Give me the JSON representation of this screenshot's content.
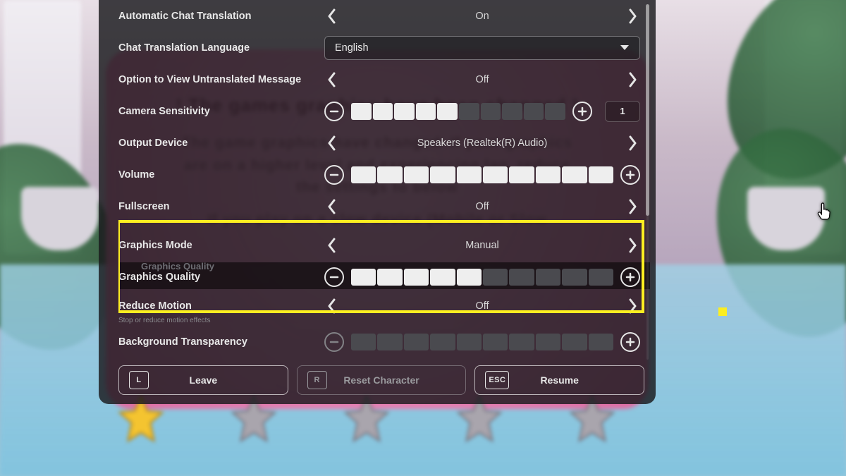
{
  "settings": {
    "autoChatTranslation": {
      "label": "Automatic Chat Translation",
      "value": "On"
    },
    "chatTranslationLanguage": {
      "label": "Chat Translation Language",
      "value": "English"
    },
    "viewUntranslated": {
      "label": "Option to View Untranslated Message",
      "value": "Off"
    },
    "cameraSensitivity": {
      "label": "Camera Sensitivity",
      "filled": 5,
      "total": 10,
      "numeric": "1"
    },
    "outputDevice": {
      "label": "Output Device",
      "value": "Speakers (Realtek(R) Audio)"
    },
    "volume": {
      "label": "Volume",
      "filled": 10,
      "total": 10
    },
    "fullscreen": {
      "label": "Fullscreen",
      "value": "Off"
    },
    "graphicsMode": {
      "label": "Graphics Mode",
      "value": "Manual"
    },
    "graphicsQuality": {
      "label": "Graphics Quality",
      "filled": 5,
      "total": 10
    },
    "reduceMotion": {
      "label": "Reduce Motion",
      "value": "Off",
      "subtext": "Stop or reduce motion effects"
    },
    "backgroundTransparency": {
      "label": "Background Transparency",
      "filled": 0,
      "total": 10
    }
  },
  "buttons": {
    "leave": {
      "key": "L",
      "label": "Leave"
    },
    "reset": {
      "key": "R",
      "label": "Reset Character"
    },
    "resume": {
      "key": "ESC",
      "label": "Resume"
    }
  },
  "bgPopup": {
    "title": "! The games graphics have been changed !",
    "line1": "The game graphics have changed. If your graphics",
    "line2": "are on a higher level and experiencing lag, reduce",
    "line3": "the settings to below",
    "line4": "If you play on a slow device (Mobile or Slow",
    "graphicsQualityLabel": "Graphics Quality"
  },
  "colors": {
    "highlight": "#fcee21"
  }
}
